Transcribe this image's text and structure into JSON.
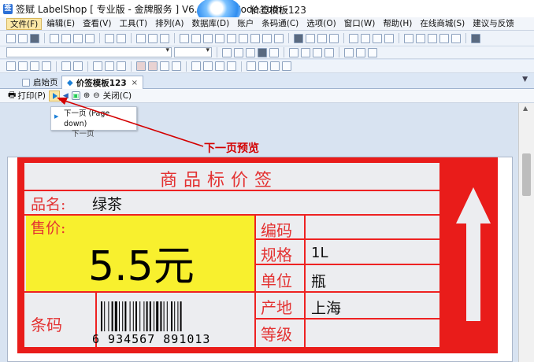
{
  "window": {
    "title": "签赋 LabelShop [ 专业版 - 金牌服务 ]  V6.20  [360Code.com -",
    "title_suffix": "价签模板123"
  },
  "menu": [
    "文件(F)",
    "编辑(E)",
    "查看(V)",
    "工具(T)",
    "排列(A)",
    "数据库(D)",
    "账户",
    "条码通(C)",
    "选项(O)",
    "窗口(W)",
    "帮助(H)",
    "在线商城(S)",
    "建议与反馈"
  ],
  "tabs": {
    "home": "启始页",
    "doc": "价签模板123",
    "close": "×"
  },
  "preview_toolbar": {
    "print": "打印(P)",
    "close": "关闭(C)"
  },
  "tooltip": {
    "title": "下一页 (Page down)",
    "subtitle": "下一页"
  },
  "annotation": "下一页预览",
  "price_tag": {
    "header": "商品标价签",
    "name_label": "品名:",
    "name_value": "绿茶",
    "price_label": "售价:",
    "price_value": "5.5元",
    "code_label": "编码",
    "spec_label": "规格",
    "spec_value": "1L",
    "unit_label": "单位",
    "unit_value": "瓶",
    "origin_label": "产地",
    "origin_value": "上海",
    "grade_label": "等级",
    "barcode_label": "条码",
    "barcode_number": "6 934567 891013"
  },
  "colors": {
    "tag_red": "#e91c1a",
    "price_yellow": "#f8f02e",
    "annotation_red": "#d40000"
  }
}
